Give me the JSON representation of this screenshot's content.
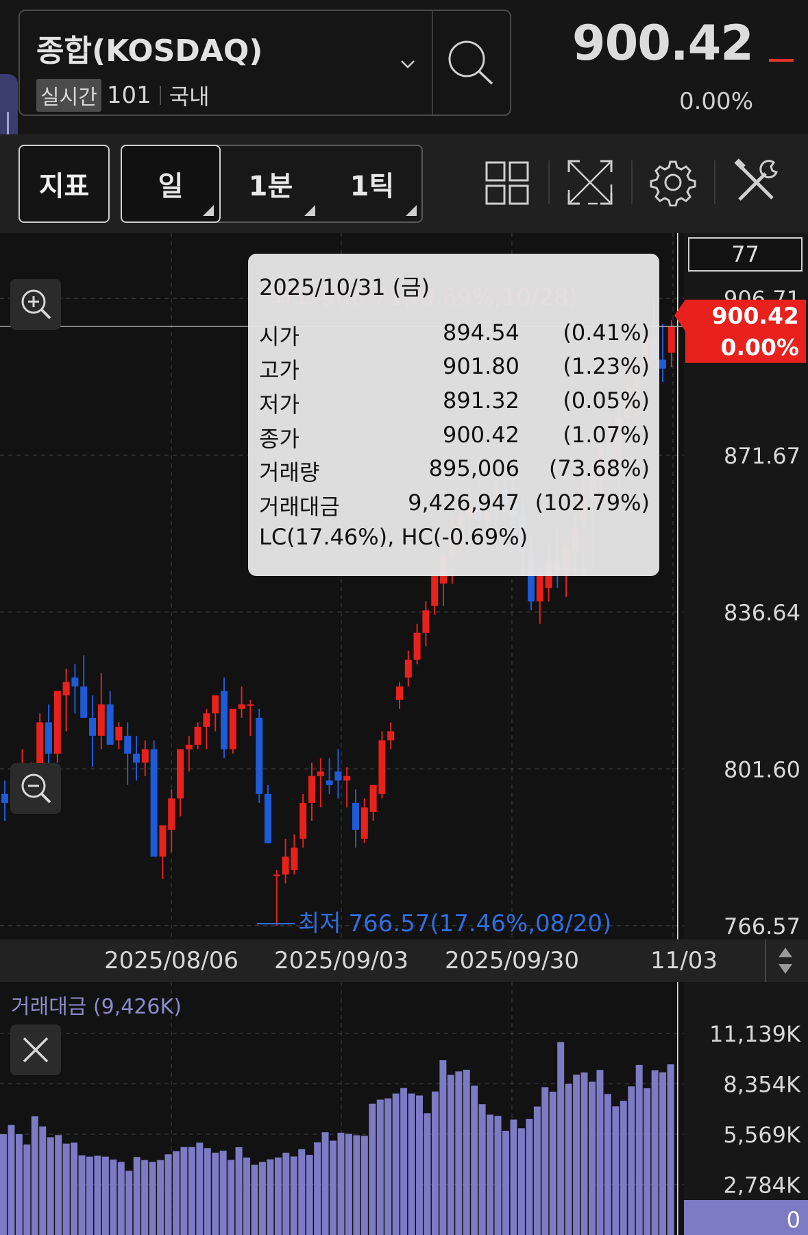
{
  "header": {
    "symbol": "종합(KOSDAQ)",
    "realtime_badge": "실시간",
    "code": "101",
    "market": "국내",
    "price": "900.42",
    "change_pct": "0.00%"
  },
  "toolbar": {
    "indicator_label": "지표",
    "periods": [
      "일",
      "1분",
      "1틱"
    ]
  },
  "main_chart": {
    "candle_count": "77",
    "current_price_tag": "900.42",
    "current_pct_tag": "0.00%",
    "y_ticks": [
      "906.71",
      "871.67",
      "836.64",
      "801.60",
      "766.57"
    ],
    "high_marker": "최고 906.71(-0.69%,10/28)",
    "low_marker": "최저 766.57(17.46%,08/20)",
    "x_ticks": [
      "2025/08/06",
      "2025/09/03",
      "2025/09/30",
      "11/03"
    ]
  },
  "tooltip": {
    "date": "2025/10/31 (금)",
    "rows": [
      {
        "label": "시가",
        "value": "894.54",
        "pct": "(0.41%)"
      },
      {
        "label": "고가",
        "value": "901.80",
        "pct": "(1.23%)"
      },
      {
        "label": "저가",
        "value": "891.32",
        "pct": "(0.05%)"
      },
      {
        "label": "종가",
        "value": "900.42",
        "pct": "(1.07%)"
      },
      {
        "label": "거래량",
        "value": "895,006",
        "pct": "(73.68%)"
      },
      {
        "label": "거래대금",
        "value": "9,426,947",
        "pct": "(102.79%)"
      }
    ],
    "footer": "LC(17.46%), HC(-0.69%)"
  },
  "volume_chart": {
    "title": "거래대금 (9,426K)",
    "y_ticks": [
      "11,139K",
      "8,354K",
      "5,569K",
      "2,784K",
      "0"
    ]
  },
  "colors": {
    "up": "#e8211d",
    "down": "#1e5bd8",
    "volume": "#7c7bc4",
    "low_marker": "#2f6fe0",
    "high_marker": "#e8211d"
  },
  "chart_data": {
    "type": "candlestick",
    "ylim": [
      766.57,
      906.71
    ],
    "ohlc": [
      [
        796,
        799,
        790,
        794
      ],
      [
        794,
        802,
        792,
        799
      ],
      [
        799,
        806,
        796,
        800
      ],
      [
        795,
        803,
        794,
        798
      ],
      [
        798,
        814,
        794,
        812
      ],
      [
        812,
        816,
        801,
        805
      ],
      [
        805,
        817,
        803,
        819
      ],
      [
        818,
        824,
        810,
        821
      ],
      [
        822,
        825,
        814,
        820
      ],
      [
        820,
        827,
        815,
        813
      ],
      [
        813,
        818,
        802,
        809
      ],
      [
        809,
        823,
        806,
        816
      ],
      [
        816,
        819,
        808,
        807
      ],
      [
        808,
        812,
        806,
        811
      ],
      [
        809,
        812,
        798,
        805
      ],
      [
        805,
        809,
        799,
        803
      ],
      [
        803,
        808,
        800,
        806
      ],
      [
        806,
        808,
        783,
        782
      ],
      [
        782,
        789,
        777,
        789
      ],
      [
        788,
        797,
        783,
        795
      ],
      [
        795,
        806,
        791,
        806
      ],
      [
        806,
        809,
        801,
        807
      ],
      [
        807,
        812,
        806,
        811
      ],
      [
        811,
        815,
        806,
        814
      ],
      [
        814,
        818,
        810,
        818
      ],
      [
        819,
        822,
        804,
        806
      ],
      [
        806,
        815,
        805,
        815
      ],
      [
        815,
        820,
        813,
        816
      ],
      [
        816,
        817,
        809,
        816
      ],
      [
        813,
        815,
        794,
        796
      ],
      [
        796,
        798,
        789,
        785
      ],
      [
        778,
        779,
        766.57,
        778
      ],
      [
        778,
        786,
        776,
        782
      ],
      [
        779,
        787,
        778,
        784
      ],
      [
        786,
        796,
        784,
        794
      ],
      [
        794,
        803,
        790,
        800
      ],
      [
        800,
        804,
        793,
        801
      ],
      [
        799,
        804,
        796,
        798
      ],
      [
        801,
        806,
        795,
        799
      ],
      [
        799,
        802,
        793,
        800
      ],
      [
        794,
        797,
        784,
        788
      ],
      [
        786,
        795,
        785,
        793
      ],
      [
        792,
        798,
        790,
        798
      ],
      [
        796,
        810,
        795,
        808
      ],
      [
        808,
        812,
        806,
        810
      ],
      [
        817,
        821,
        815,
        820
      ],
      [
        822,
        828,
        820,
        826
      ],
      [
        826,
        834,
        825,
        832
      ],
      [
        832,
        839,
        829,
        837
      ],
      [
        838,
        845,
        836,
        845
      ],
      [
        843,
        852,
        838,
        849
      ],
      [
        849,
        858,
        843,
        854
      ],
      [
        855,
        862,
        850,
        858
      ],
      [
        858,
        864,
        852,
        860
      ],
      [
        860,
        867,
        855,
        857
      ],
      [
        857,
        862,
        852,
        859
      ],
      [
        859,
        866,
        855,
        864
      ],
      [
        864,
        870,
        860,
        861
      ],
      [
        861,
        868,
        854,
        858
      ],
      [
        858,
        862,
        845,
        850
      ],
      [
        850,
        854,
        837,
        839
      ],
      [
        839,
        850,
        834,
        845
      ],
      [
        842,
        852,
        839,
        848
      ],
      [
        848,
        856,
        842,
        846
      ],
      [
        846,
        853,
        840,
        851
      ],
      [
        850,
        858,
        845,
        855
      ],
      [
        857,
        866,
        845,
        862
      ],
      [
        862,
        870,
        847,
        868
      ],
      [
        868,
        876,
        862,
        873
      ],
      [
        873,
        880,
        865,
        868
      ],
      [
        868,
        884,
        864,
        880
      ],
      [
        880,
        889,
        872,
        884
      ],
      [
        884,
        895,
        879,
        892
      ],
      [
        892,
        902,
        888,
        898
      ],
      [
        898,
        906.71,
        895,
        893
      ],
      [
        893,
        901,
        888,
        891
      ],
      [
        894.54,
        901.8,
        891.32,
        900.42
      ]
    ],
    "volume_k": [
      5570,
      6080,
      5570,
      5000,
      6560,
      6000,
      5400,
      5520,
      5050,
      5100,
      4400,
      4330,
      4380,
      4330,
      4170,
      4040,
      3550,
      4310,
      4140,
      4040,
      4140,
      4460,
      4630,
      4860,
      4860,
      5100,
      4800,
      4550,
      4660,
      4150,
      4850,
      4280,
      3880,
      4040,
      4180,
      4280,
      4550,
      4340,
      4740,
      4430,
      5120,
      5680,
      5210,
      5650,
      5590,
      5510,
      5480,
      7250,
      7480,
      7550,
      7820,
      8120,
      7820,
      7710,
      6730,
      7930,
      9660,
      8850,
      9040,
      9130,
      8250,
      7230,
      6650,
      6580,
      5760,
      6380,
      5900,
      6410,
      7100,
      8170,
      7920,
      10660,
      8350,
      8860,
      8980,
      8470,
      9120,
      7790,
      7110,
      7410,
      8210,
      9400,
      8110,
      9100,
      8990,
      9430
    ]
  }
}
